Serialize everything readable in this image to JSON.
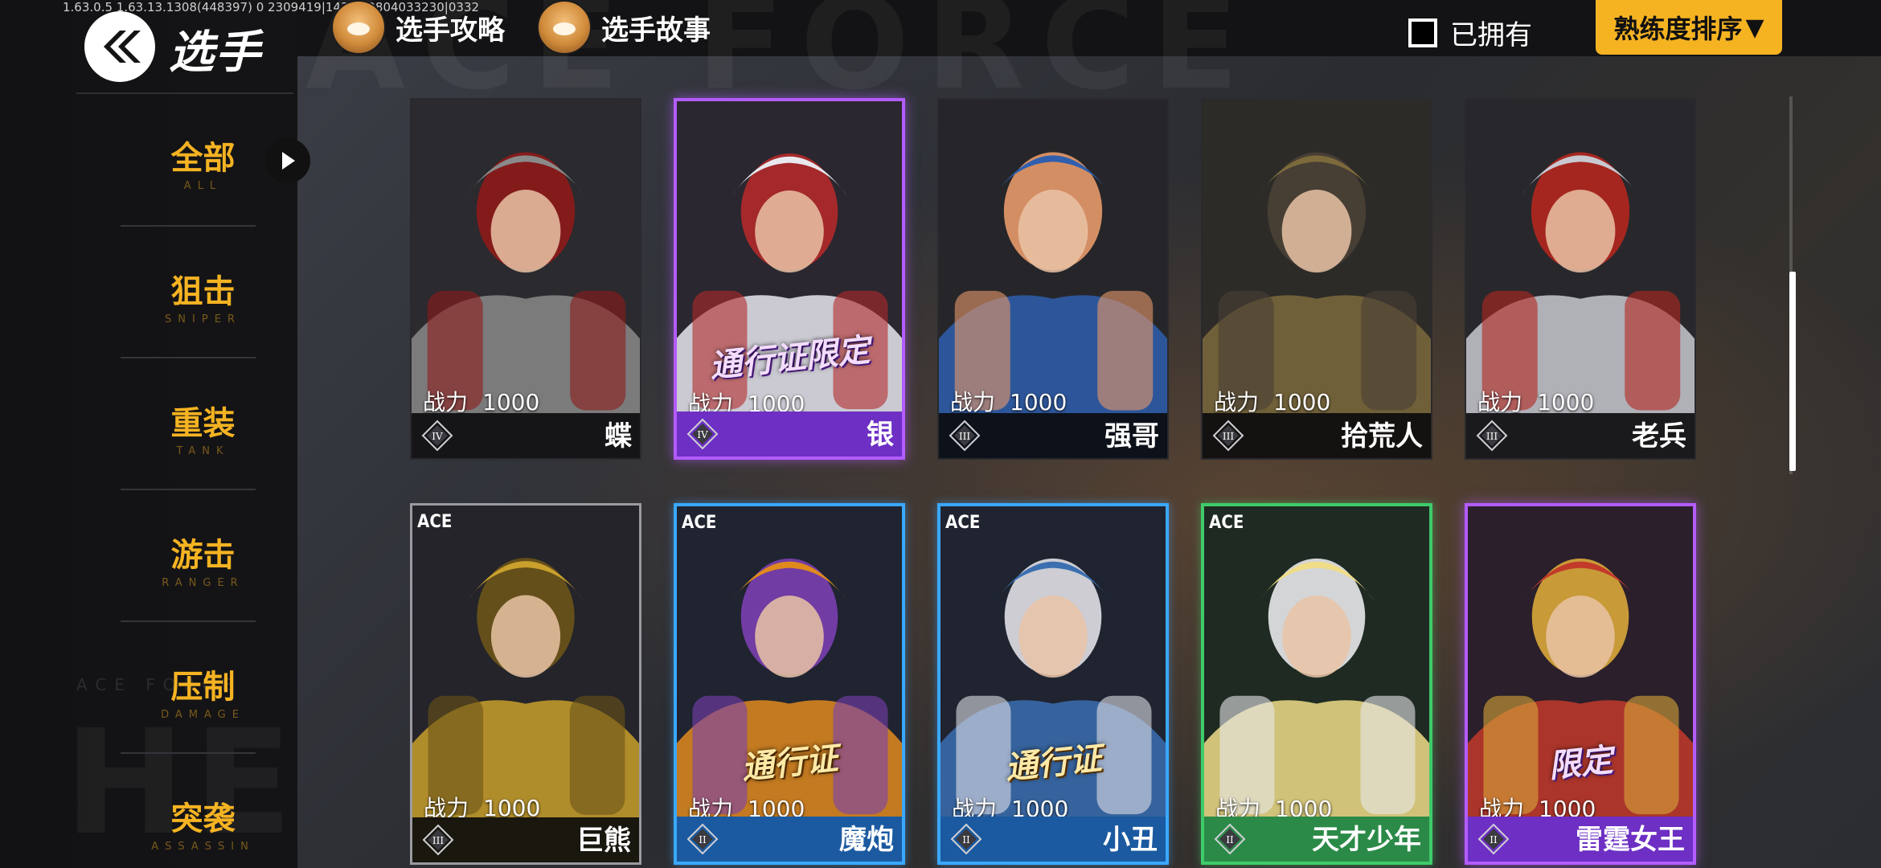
{
  "status": {
    "version": "1.63.0.5  1.63.13.1308(448397)  0  2309419|14343    0804033230|0332"
  },
  "header": {
    "title": "选手",
    "links": [
      {
        "label": "选手攻略",
        "icon": "shiba-avatar-icon"
      },
      {
        "label": "选手故事",
        "icon": "shiba-avatar-icon"
      }
    ],
    "owned_label": "已拥有",
    "owned_checked": false,
    "sort_label": "熟练度排序",
    "sort_arrow": "▼"
  },
  "sidebar": {
    "items": [
      {
        "zh": "全部",
        "en": "ALL",
        "active": true
      },
      {
        "zh": "狙击",
        "en": "SNIPER",
        "active": false
      },
      {
        "zh": "重装",
        "en": "TANK",
        "active": false
      },
      {
        "zh": "游击",
        "en": "RANGER",
        "active": false
      },
      {
        "zh": "压制",
        "en": "DAMAGE",
        "active": false
      },
      {
        "zh": "突袭",
        "en": "ASSASSIN",
        "active": false
      }
    ],
    "watermark": "ACE FORCE"
  },
  "scroll": {
    "position": 0.46
  },
  "cards": [
    {
      "name": "蝶",
      "power_label": "战力",
      "power": "1000",
      "tier": "IV",
      "ace": "",
      "badge": "",
      "frame": "none",
      "palette": [
        "#2b2a2e",
        "#8a8a8a",
        "#8e1a1a"
      ]
    },
    {
      "name": "银",
      "power_label": "战力",
      "power": "1000",
      "tier": "IV",
      "ace": "",
      "badge": "通行证限定",
      "frame": "purple",
      "palette": [
        "#2a2730",
        "#e8e8ee",
        "#b22a2a"
      ]
    },
    {
      "name": "强哥",
      "power_label": "战力",
      "power": "1000",
      "tier": "III",
      "ace": "",
      "badge": "",
      "frame": "none",
      "palette": [
        "#26262a",
        "#2f5fae",
        "#e89a6a"
      ]
    },
    {
      "name": "拾荒人",
      "power_label": "战力",
      "power": "1000",
      "tier": "III",
      "ace": "",
      "badge": "",
      "frame": "none",
      "palette": [
        "#2d2b28",
        "#7d6a3c",
        "#4a4035"
      ]
    },
    {
      "name": "老兵",
      "power_label": "战力",
      "power": "1000",
      "tier": "III",
      "ace": "",
      "badge": "",
      "frame": "none",
      "palette": [
        "#28282c",
        "#c8c8d0",
        "#b3261e"
      ]
    },
    {
      "name": "巨熊",
      "power_label": "战力",
      "power": "1000",
      "tier": "III",
      "ace": "ACE",
      "badge": "",
      "frame": "white",
      "palette": [
        "#24242a",
        "#c9a02c",
        "#6b5418"
      ]
    },
    {
      "name": "魔炮",
      "power_label": "战力",
      "power": "1000",
      "tier": "II",
      "ace": "ACE",
      "badge": "通行证",
      "frame": "blue",
      "palette": [
        "#1f2430",
        "#e08a1e",
        "#7a3fb0"
      ]
    },
    {
      "name": "小丑",
      "power_label": "战力",
      "power": "1000",
      "tier": "II",
      "ace": "ACE",
      "badge": "通行证",
      "frame": "blue",
      "palette": [
        "#1f2430",
        "#3b6fb0",
        "#e0e0e6"
      ]
    },
    {
      "name": "天才少年",
      "power_label": "战力",
      "power": "1000",
      "tier": "II",
      "ace": "ACE",
      "badge": "",
      "frame": "green",
      "palette": [
        "#1e2a22",
        "#f0dd88",
        "#e8e8ea"
      ]
    },
    {
      "name": "雷霆女王",
      "power_label": "战力",
      "power": "1000",
      "tier": "II",
      "ace": "",
      "badge": "限定",
      "frame": "purple",
      "palette": [
        "#2a1f2a",
        "#c23a2a",
        "#d9a73a"
      ]
    }
  ],
  "colors": {
    "accent": "#f5b322",
    "purple": "#b35cff",
    "blue": "#3aa8ff",
    "green": "#3ecb6a"
  }
}
